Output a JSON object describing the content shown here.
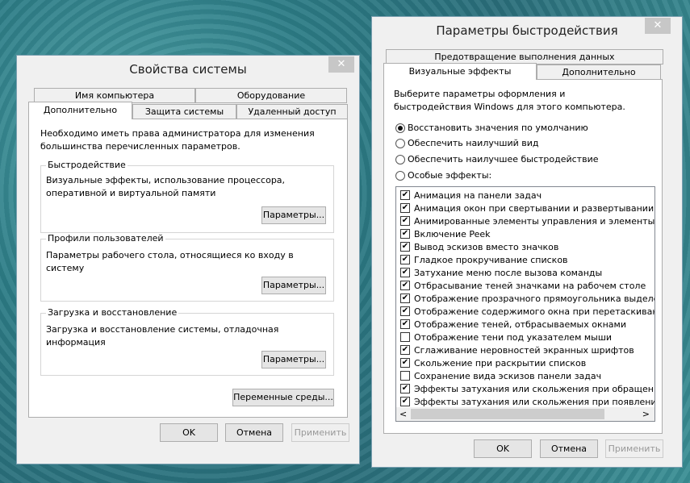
{
  "system_properties": {
    "title": "Свойства системы",
    "close": "✕",
    "tabs_row1": [
      "Имя компьютера",
      "Оборудование"
    ],
    "tabs_row2": [
      "Дополнительно",
      "Защита системы",
      "Удаленный доступ"
    ],
    "admin_note": "Необходимо иметь права администратора для изменения большинства перечисленных параметров.",
    "groups": [
      {
        "label": "Быстродействие",
        "text": "Визуальные эффекты, использование процессора, оперативной и виртуальной памяти",
        "button": "Параметры..."
      },
      {
        "label": "Профили пользователей",
        "text": "Параметры рабочего стола, относящиеся ко входу в систему",
        "button": "Параметры..."
      },
      {
        "label": "Загрузка и восстановление",
        "text": "Загрузка и восстановление системы, отладочная информация",
        "button": "Параметры..."
      }
    ],
    "env_button": "Переменные среды...",
    "ok": "OK",
    "cancel": "Отмена",
    "apply": "Применить"
  },
  "performance_options": {
    "title": "Параметры быстродействия",
    "close": "✕",
    "tab_row1": "Предотвращение выполнения данных",
    "tabs_row2": [
      "Визуальные эффекты",
      "Дополнительно"
    ],
    "intro": "Выберите параметры оформления и быстродействия Windows для этого компьютера.",
    "radios": [
      {
        "label": "Восстановить значения по умолчанию",
        "selected": true
      },
      {
        "label": "Обеспечить наилучший вид",
        "selected": false
      },
      {
        "label": "Обеспечить наилучшее быстродействие",
        "selected": false
      },
      {
        "label": "Особые эффекты:",
        "selected": false
      }
    ],
    "effects": [
      {
        "label": "Анимация на панели задач",
        "checked": true
      },
      {
        "label": "Анимация окон при свертывании и развертывании",
        "checked": true
      },
      {
        "label": "Анимированные элементы управления и элементы внутри",
        "checked": true
      },
      {
        "label": "Включение Peek",
        "checked": true
      },
      {
        "label": "Вывод эскизов вместо значков",
        "checked": true
      },
      {
        "label": "Гладкое прокручивание списков",
        "checked": true
      },
      {
        "label": "Затухание меню после вызова команды",
        "checked": true
      },
      {
        "label": "Отбрасывание теней значками на рабочем столе",
        "checked": true
      },
      {
        "label": "Отображение прозрачного прямоугольника выделения",
        "checked": true
      },
      {
        "label": "Отображение содержимого окна при перетаскивании",
        "checked": true
      },
      {
        "label": "Отображение теней, отбрасываемых окнами",
        "checked": true
      },
      {
        "label": "Отображение тени под указателем мыши",
        "checked": false
      },
      {
        "label": "Сглаживание неровностей экранных шрифтов",
        "checked": true
      },
      {
        "label": "Скольжение при раскрытии списков",
        "checked": true
      },
      {
        "label": "Сохранение вида эскизов панели задач",
        "checked": false
      },
      {
        "label": "Эффекты затухания или скольжения при обращении к меню",
        "checked": true
      },
      {
        "label": "Эффекты затухания или скольжения при появлении подсказок",
        "checked": true
      }
    ],
    "scroll_left": "<",
    "scroll_right": ">",
    "ok": "OK",
    "cancel": "Отмена",
    "apply": "Применить"
  }
}
